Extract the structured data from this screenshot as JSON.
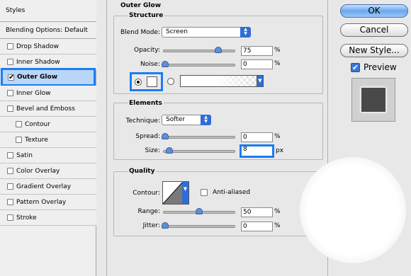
{
  "styles_panel": {
    "header": "Styles",
    "blending": "Blending Options: Default",
    "items": [
      {
        "label": "Drop Shadow",
        "checked": false
      },
      {
        "label": "Inner Shadow",
        "checked": false
      },
      {
        "label": "Outer Glow",
        "checked": true,
        "selected": true
      },
      {
        "label": "Inner Glow",
        "checked": false
      },
      {
        "label": "Bevel and Emboss",
        "checked": false
      },
      {
        "label": "Contour",
        "checked": false
      },
      {
        "label": "Texture",
        "checked": false
      },
      {
        "label": "Satin",
        "checked": false
      },
      {
        "label": "Color Overlay",
        "checked": false
      },
      {
        "label": "Gradient Overlay",
        "checked": false
      },
      {
        "label": "Pattern Overlay",
        "checked": false
      },
      {
        "label": "Stroke",
        "checked": false
      }
    ]
  },
  "outer_glow": {
    "title": "Outer Glow",
    "structure": {
      "title": "Structure",
      "blend_mode_label": "Blend Mode:",
      "blend_mode_value": "Screen",
      "opacity_label": "Opacity:",
      "opacity_value": "75",
      "opacity_unit": "%",
      "noise_label": "Noise:",
      "noise_value": "0",
      "noise_unit": "%"
    },
    "elements": {
      "title": "Elements",
      "technique_label": "Technique:",
      "technique_value": "Softer",
      "spread_label": "Spread:",
      "spread_value": "0",
      "spread_unit": "%",
      "size_label": "Size:",
      "size_value": "8",
      "size_unit": "px"
    },
    "quality": {
      "title": "Quality",
      "contour_label": "Contour:",
      "anti_aliased_label": "Anti-aliased",
      "range_label": "Range:",
      "range_value": "50",
      "range_unit": "%",
      "jitter_label": "Jitter:",
      "jitter_value": "0",
      "jitter_unit": "%"
    }
  },
  "buttons": {
    "ok": "OK",
    "cancel": "Cancel",
    "new_style": "New Style..."
  },
  "preview": {
    "label": "Preview",
    "checked": true
  },
  "colors": {
    "accent": "#1a7ef4",
    "selection": "#b9d6f6",
    "preview_swatch": "#494949"
  }
}
